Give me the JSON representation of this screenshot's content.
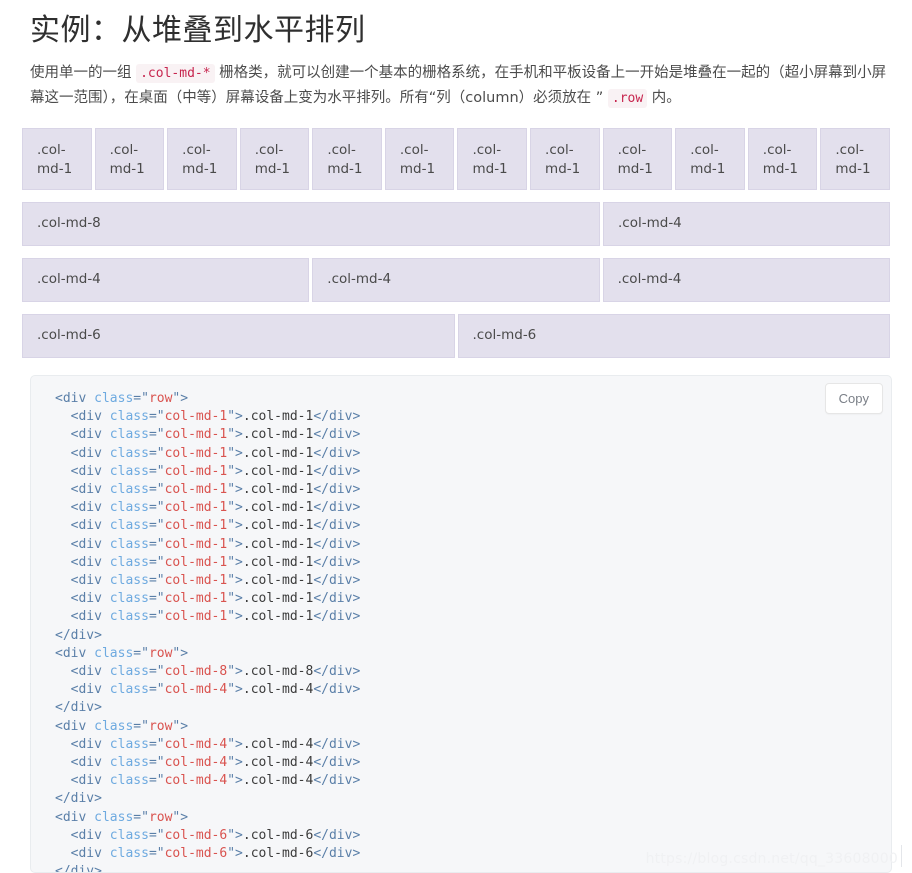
{
  "page": {
    "title": "实例：从堆叠到水平排列",
    "intro": {
      "part1": "使用单一的一组 ",
      "code1": ".col-md-*",
      "part2": " 栅格类，就可以创建一个基本的栅格系统，在手机和平板设备上一开始是堆叠在一起的（超小屏幕到小屏幕这一范围），在桌面（中等）屏幕设备上变为水平排列。所有“列（column）必须放在 ” ",
      "code2": ".row",
      "part3": " 内。"
    },
    "watermark": "https://blog.csdn.net/qq_33608000"
  },
  "colors": {
    "column_bg": "#e3e0ed",
    "column_border": "#d8d4e6",
    "code_bg": "#f6f7f9",
    "code_border": "#e9ecef",
    "inline_code_text": "#c7254e",
    "inline_code_bg": "#f9f2f4",
    "token_tag": "#5a7fa8",
    "token_attr": "#6eaae0",
    "token_string": "#d9534f",
    "token_text": "#3b3b3b",
    "watermark": "#f0f1f3"
  },
  "grid": {
    "rows": [
      {
        "name": "row-12",
        "columns": [
          {
            "label_line1": ".col-",
            "label_line2": "md-1"
          },
          {
            "label_line1": ".col-",
            "label_line2": "md-1"
          },
          {
            "label_line1": ".col-",
            "label_line2": "md-1"
          },
          {
            "label_line1": ".col-",
            "label_line2": "md-1"
          },
          {
            "label_line1": ".col-",
            "label_line2": "md-1"
          },
          {
            "label_line1": ".col-",
            "label_line2": "md-1"
          },
          {
            "label_line1": ".col-",
            "label_line2": "md-1"
          },
          {
            "label_line1": ".col-",
            "label_line2": "md-1"
          },
          {
            "label_line1": ".col-",
            "label_line2": "md-1"
          },
          {
            "label_line1": ".col-",
            "label_line2": "md-1"
          },
          {
            "label_line1": ".col-",
            "label_line2": "md-1"
          },
          {
            "label_line1": ".col-",
            "label_line2": "md-1"
          }
        ]
      },
      {
        "name": "row-8-4",
        "columns": [
          {
            "label": ".col-md-8"
          },
          {
            "label": ".col-md-4"
          }
        ]
      },
      {
        "name": "row-4-4-4",
        "columns": [
          {
            "label": ".col-md-4"
          },
          {
            "label": ".col-md-4"
          },
          {
            "label": ".col-md-4"
          }
        ]
      },
      {
        "name": "row-6-6",
        "columns": [
          {
            "label": ".col-md-6"
          },
          {
            "label": ".col-md-6"
          }
        ]
      }
    ]
  },
  "code_panel": {
    "copy_label": "Copy",
    "language": "html",
    "lines": [
      {
        "indent": 0,
        "type": "open_row"
      },
      {
        "indent": 1,
        "type": "col",
        "cls": "col-md-1",
        "text": ".col-md-1"
      },
      {
        "indent": 1,
        "type": "col",
        "cls": "col-md-1",
        "text": ".col-md-1"
      },
      {
        "indent": 1,
        "type": "col",
        "cls": "col-md-1",
        "text": ".col-md-1"
      },
      {
        "indent": 1,
        "type": "col",
        "cls": "col-md-1",
        "text": ".col-md-1"
      },
      {
        "indent": 1,
        "type": "col",
        "cls": "col-md-1",
        "text": ".col-md-1"
      },
      {
        "indent": 1,
        "type": "col",
        "cls": "col-md-1",
        "text": ".col-md-1"
      },
      {
        "indent": 1,
        "type": "col",
        "cls": "col-md-1",
        "text": ".col-md-1"
      },
      {
        "indent": 1,
        "type": "col",
        "cls": "col-md-1",
        "text": ".col-md-1"
      },
      {
        "indent": 1,
        "type": "col",
        "cls": "col-md-1",
        "text": ".col-md-1"
      },
      {
        "indent": 1,
        "type": "col",
        "cls": "col-md-1",
        "text": ".col-md-1"
      },
      {
        "indent": 1,
        "type": "col",
        "cls": "col-md-1",
        "text": ".col-md-1"
      },
      {
        "indent": 1,
        "type": "col",
        "cls": "col-md-1",
        "text": ".col-md-1"
      },
      {
        "indent": 0,
        "type": "close"
      },
      {
        "indent": 0,
        "type": "open_row"
      },
      {
        "indent": 1,
        "type": "col",
        "cls": "col-md-8",
        "text": ".col-md-8"
      },
      {
        "indent": 1,
        "type": "col",
        "cls": "col-md-4",
        "text": ".col-md-4"
      },
      {
        "indent": 0,
        "type": "close"
      },
      {
        "indent": 0,
        "type": "open_row"
      },
      {
        "indent": 1,
        "type": "col",
        "cls": "col-md-4",
        "text": ".col-md-4"
      },
      {
        "indent": 1,
        "type": "col",
        "cls": "col-md-4",
        "text": ".col-md-4"
      },
      {
        "indent": 1,
        "type": "col",
        "cls": "col-md-4",
        "text": ".col-md-4"
      },
      {
        "indent": 0,
        "type": "close"
      },
      {
        "indent": 0,
        "type": "open_row"
      },
      {
        "indent": 1,
        "type": "col",
        "cls": "col-md-6",
        "text": ".col-md-6"
      },
      {
        "indent": 1,
        "type": "col",
        "cls": "col-md-6",
        "text": ".col-md-6"
      },
      {
        "indent": 0,
        "type": "close"
      }
    ],
    "tokens": {
      "tag_open": "<div",
      "tag_close": "</div>",
      "attr_name": "class",
      "eq_quote": "=\"",
      "quote_gt": "\">",
      "gt": ">",
      "row_value": "row"
    }
  }
}
